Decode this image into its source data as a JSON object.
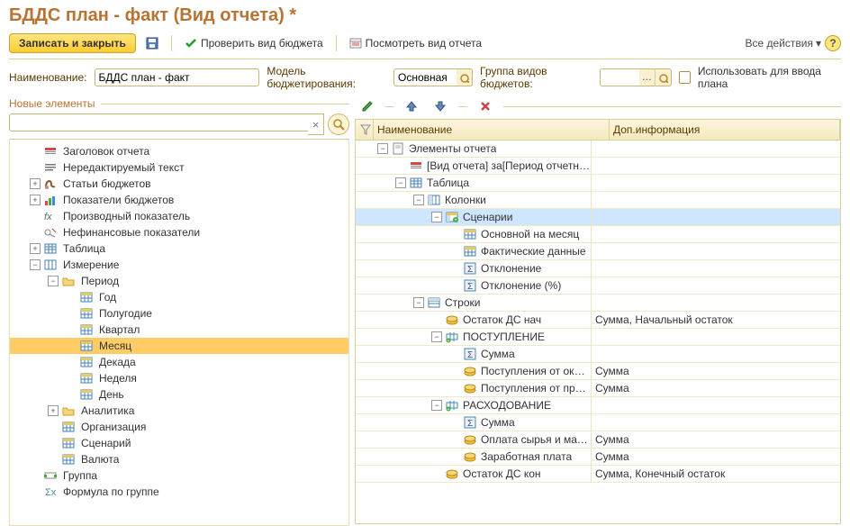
{
  "title": "БДДС план - факт (Вид отчета) *",
  "toolbar": {
    "save_close": "Записать и закрыть",
    "check": "Проверить вид бюджета",
    "preview": "Посмотреть вид отчета",
    "all_actions": "Все действия"
  },
  "form": {
    "name_label": "Наименование:",
    "name_value": "БДДС план - факт",
    "model_label": "Модель бюджетирования:",
    "model_value": "Основная",
    "group_label": "Группа видов бюджетов:",
    "group_value": "",
    "use_for_input": "Использовать для ввода плана"
  },
  "left": {
    "header": "Новые элементы",
    "items": [
      {
        "indent": 0,
        "exp": "",
        "icon": "header",
        "label": "Заголовок отчета"
      },
      {
        "indent": 0,
        "exp": "",
        "icon": "text",
        "label": "Нередактируемый текст"
      },
      {
        "indent": 0,
        "exp": "+",
        "icon": "articles",
        "label": "Статьи бюджетов"
      },
      {
        "indent": 0,
        "exp": "+",
        "icon": "indicators",
        "label": "Показатели бюджетов"
      },
      {
        "indent": 0,
        "exp": "",
        "icon": "fx",
        "label": "Производный показатель"
      },
      {
        "indent": 0,
        "exp": "",
        "icon": "nonfin",
        "label": "Нефинансовые показатели"
      },
      {
        "indent": 0,
        "exp": "+",
        "icon": "table",
        "label": "Таблица"
      },
      {
        "indent": 0,
        "exp": "-",
        "icon": "dim",
        "label": "Измерение"
      },
      {
        "indent": 1,
        "exp": "-",
        "icon": "folder",
        "label": "Период"
      },
      {
        "indent": 2,
        "exp": "",
        "icon": "cal",
        "label": "Год"
      },
      {
        "indent": 2,
        "exp": "",
        "icon": "cal",
        "label": "Полугодие"
      },
      {
        "indent": 2,
        "exp": "",
        "icon": "cal",
        "label": "Квартал"
      },
      {
        "indent": 2,
        "exp": "",
        "icon": "cal",
        "label": "Месяц",
        "selected": true
      },
      {
        "indent": 2,
        "exp": "",
        "icon": "cal",
        "label": "Декада"
      },
      {
        "indent": 2,
        "exp": "",
        "icon": "cal",
        "label": "Неделя"
      },
      {
        "indent": 2,
        "exp": "",
        "icon": "cal",
        "label": "День"
      },
      {
        "indent": 1,
        "exp": "+",
        "icon": "folder",
        "label": "Аналитика"
      },
      {
        "indent": 1,
        "exp": "",
        "icon": "cal",
        "label": "Организация"
      },
      {
        "indent": 1,
        "exp": "",
        "icon": "cal",
        "label": "Сценарий"
      },
      {
        "indent": 1,
        "exp": "",
        "icon": "cal",
        "label": "Валюта"
      },
      {
        "indent": 0,
        "exp": "",
        "icon": "group",
        "label": "Группа"
      },
      {
        "indent": 0,
        "exp": "",
        "icon": "formula",
        "label": "Формула по группе"
      }
    ]
  },
  "right": {
    "col_name": "Наименование",
    "col_info": "Доп.информация",
    "rows": [
      {
        "indent": 0,
        "exp": "-",
        "icon": "report",
        "label": "Элементы отчета",
        "info": ""
      },
      {
        "indent": 1,
        "exp": "",
        "icon": "header",
        "label": "[Вид отчета] за[Период отчетности]",
        "info": ""
      },
      {
        "indent": 1,
        "exp": "-",
        "icon": "table",
        "label": "Таблица",
        "info": ""
      },
      {
        "indent": 2,
        "exp": "-",
        "icon": "cols",
        "label": "Колонки",
        "info": ""
      },
      {
        "indent": 3,
        "exp": "-",
        "icon": "scen",
        "label": "Сценарии",
        "info": "",
        "selected": true
      },
      {
        "indent": 4,
        "exp": "",
        "icon": "cal",
        "label": "Основной на месяц",
        "info": ""
      },
      {
        "indent": 4,
        "exp": "",
        "icon": "cal",
        "label": "Фактические данные",
        "info": ""
      },
      {
        "indent": 4,
        "exp": "",
        "icon": "sigma",
        "label": "Отклонение",
        "info": ""
      },
      {
        "indent": 4,
        "exp": "",
        "icon": "sigma",
        "label": "Отклонение (%)",
        "info": ""
      },
      {
        "indent": 2,
        "exp": "-",
        "icon": "rows",
        "label": "Строки",
        "info": ""
      },
      {
        "indent": 3,
        "exp": "",
        "icon": "coins",
        "label": "Остаток ДС нач",
        "info": "Сумма, Начальный остаток"
      },
      {
        "indent": 3,
        "exp": "-",
        "icon": "flow",
        "label": "ПОСТУПЛЕНИЕ",
        "info": ""
      },
      {
        "indent": 4,
        "exp": "",
        "icon": "sigma",
        "label": "Сумма",
        "info": ""
      },
      {
        "indent": 4,
        "exp": "",
        "icon": "coins",
        "label": "Поступления от оказа...",
        "info": "Сумма"
      },
      {
        "indent": 4,
        "exp": "",
        "icon": "coins",
        "label": "Поступления от прода...",
        "info": "Сумма"
      },
      {
        "indent": 3,
        "exp": "-",
        "icon": "flow",
        "label": "РАСХОДОВАНИЕ",
        "info": ""
      },
      {
        "indent": 4,
        "exp": "",
        "icon": "sigma",
        "label": "Сумма",
        "info": ""
      },
      {
        "indent": 4,
        "exp": "",
        "icon": "coins",
        "label": "Оплата сырья и мате...",
        "info": "Сумма"
      },
      {
        "indent": 4,
        "exp": "",
        "icon": "coins",
        "label": "Заработная плата",
        "info": "Сумма"
      },
      {
        "indent": 3,
        "exp": "",
        "icon": "coins",
        "label": "Остаток ДС кон",
        "info": "Сумма, Конечный остаток"
      }
    ]
  }
}
